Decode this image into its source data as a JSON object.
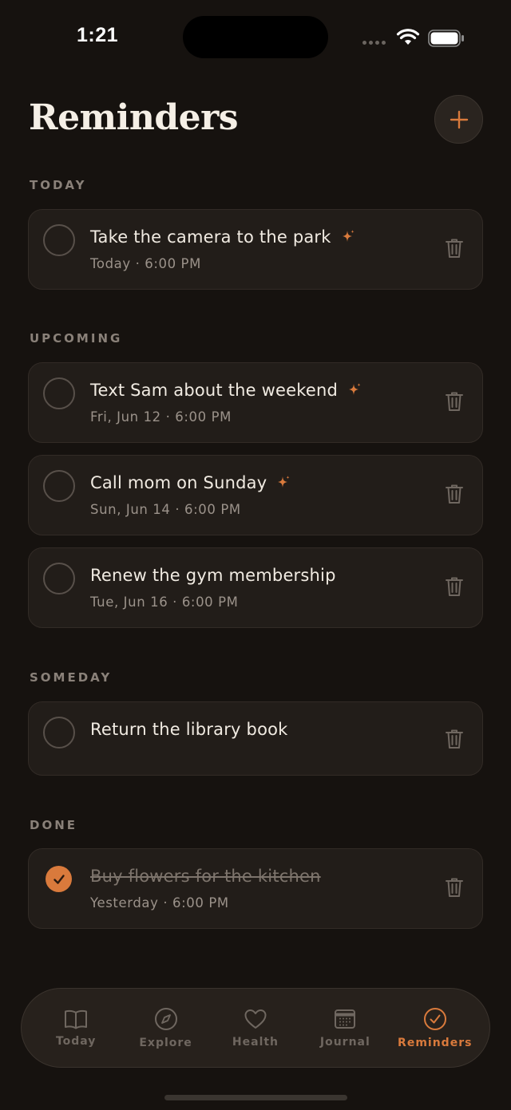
{
  "status_bar": {
    "time": "1:21"
  },
  "header": {
    "title": "Reminders"
  },
  "sections": {
    "today": "TODAY",
    "upcoming": "UPCOMING",
    "someday": "SOMEDAY",
    "done": "DONE"
  },
  "reminders": [
    {
      "title": "Take the camera to the park",
      "when": "Today · 6:00 PM",
      "sparkle": true,
      "done": false
    },
    {
      "title": "Text Sam about the weekend",
      "when": "Fri, Jun 12 · 6:00 PM",
      "sparkle": true,
      "done": false
    },
    {
      "title": "Call mom on Sunday",
      "when": "Sun, Jun 14 · 6:00 PM",
      "sparkle": true,
      "done": false
    },
    {
      "title": "Renew the gym membership",
      "when": "Tue, Jun 16 · 6:00 PM",
      "sparkle": false,
      "done": false
    },
    {
      "title": "Return the library book",
      "when": "",
      "sparkle": false,
      "done": false
    },
    {
      "title": "Buy flowers for the kitchen",
      "when": "Yesterday · 6:00 PM",
      "sparkle": false,
      "done": true
    }
  ],
  "tabs": [
    {
      "label": "Today",
      "icon": "book-icon",
      "active": false
    },
    {
      "label": "Explore",
      "icon": "compass-icon",
      "active": false
    },
    {
      "label": "Health",
      "icon": "heart-icon",
      "active": false
    },
    {
      "label": "Journal",
      "icon": "calendar-icon",
      "active": false
    },
    {
      "label": "Reminders",
      "icon": "check-circle-icon",
      "active": true
    }
  ],
  "colors": {
    "accent": "#d97a3c",
    "background": "#16120f",
    "card": "#221d19"
  }
}
